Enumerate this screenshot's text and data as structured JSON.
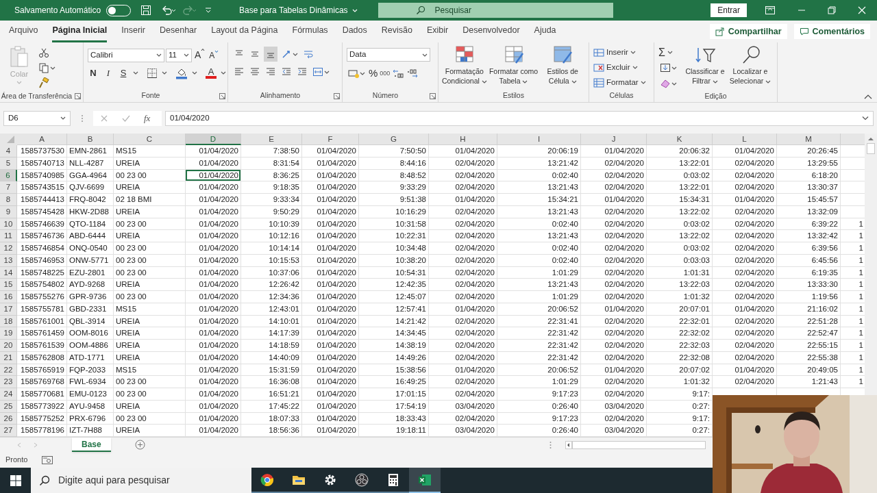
{
  "title_bar": {
    "autosave_label": "Salvamento Automático",
    "autosave_on": false,
    "document_title": "Base para Tabelas Dinâmicas",
    "search_placeholder": "Pesquisar",
    "sign_in": "Entrar"
  },
  "menu_tabs": [
    {
      "label": "Arquivo",
      "selected": false
    },
    {
      "label": "Página Inicial",
      "selected": true
    },
    {
      "label": "Inserir",
      "selected": false
    },
    {
      "label": "Desenhar",
      "selected": false
    },
    {
      "label": "Layout da Página",
      "selected": false
    },
    {
      "label": "Fórmulas",
      "selected": false
    },
    {
      "label": "Dados",
      "selected": false
    },
    {
      "label": "Revisão",
      "selected": false
    },
    {
      "label": "Exibir",
      "selected": false
    },
    {
      "label": "Desenvolvedor",
      "selected": false
    },
    {
      "label": "Ajuda",
      "selected": false
    }
  ],
  "share_buttons": [
    "Compartilhar",
    "Comentários"
  ],
  "ribbon": {
    "clipboard": {
      "label": "Área de Transferência",
      "paste": {
        "label": "Colar",
        "disabled": true
      }
    },
    "font": {
      "label": "Fonte",
      "name": "Calibri",
      "size": "11",
      "grow": "A",
      "shrink": "A",
      "styles": [
        "N",
        "I",
        "S"
      ],
      "font_color": "A"
    },
    "alignment": {
      "label": "Alinhamento",
      "vertical": [
        {
          "kind": "top",
          "selected": false
        },
        {
          "kind": "middle",
          "selected": false
        },
        {
          "kind": "bottom",
          "selected": true
        }
      ]
    },
    "number": {
      "label": "Número",
      "format": "Data",
      "percent": "%",
      "thousands": "000"
    },
    "styles": {
      "label": "Estilos",
      "buttons": [
        "Formatação Condicional",
        "Formatar como Tabela",
        "Estilos de Célula"
      ]
    },
    "cells": {
      "label": "Células",
      "buttons": [
        "Inserir",
        "Excluir",
        "Formatar"
      ]
    },
    "editing": {
      "label": "Edição",
      "sum": "Σ",
      "buttons": [
        "Classificar e Filtrar",
        "Localizar e Selecionar"
      ]
    }
  },
  "formula_bar": {
    "name_box": "D6",
    "function_label": "fx",
    "value": "01/04/2020"
  },
  "columns": [
    {
      "label": "A",
      "selected": false
    },
    {
      "label": "B",
      "selected": false
    },
    {
      "label": "C",
      "selected": false
    },
    {
      "label": "D",
      "selected": true
    },
    {
      "label": "E",
      "selected": false
    },
    {
      "label": "F",
      "selected": false
    },
    {
      "label": "G",
      "selected": false
    },
    {
      "label": "H",
      "selected": false
    },
    {
      "label": "I",
      "selected": false
    },
    {
      "label": "J",
      "selected": false
    },
    {
      "label": "K",
      "selected": false
    },
    {
      "label": "L",
      "selected": false
    },
    {
      "label": "M",
      "selected": false
    }
  ],
  "rows": [
    {
      "number": "4",
      "selected": false,
      "cells": [
        "1585737530",
        "EMN-2861",
        "MS15",
        "01/04/2020",
        "7:38:50",
        "01/04/2020",
        "7:50:50",
        "01/04/2020",
        "20:06:19",
        "01/04/2020",
        "20:06:32",
        "01/04/2020",
        "20:26:45"
      ]
    },
    {
      "number": "5",
      "selected": false,
      "cells": [
        "1585740713",
        "NLL-4287",
        "UREIA",
        "01/04/2020",
        "8:31:54",
        "01/04/2020",
        "8:44:16",
        "02/04/2020",
        "13:21:42",
        "02/04/2020",
        "13:22:01",
        "02/04/2020",
        "13:29:55"
      ]
    },
    {
      "number": "6",
      "selected": true,
      "cells": [
        "1585740985",
        "GGA-4964",
        "00 23 00",
        "01/04/2020",
        "8:36:25",
        "01/04/2020",
        "8:48:52",
        "02/04/2020",
        "0:02:40",
        "02/04/2020",
        "0:03:02",
        "02/04/2020",
        "6:18:20"
      ]
    },
    {
      "number": "7",
      "selected": false,
      "cells": [
        "1585743515",
        "QJV-6699",
        "UREIA",
        "01/04/2020",
        "9:18:35",
        "01/04/2020",
        "9:33:29",
        "02/04/2020",
        "13:21:43",
        "02/04/2020",
        "13:22:01",
        "02/04/2020",
        "13:30:37"
      ]
    },
    {
      "number": "8",
      "selected": false,
      "cells": [
        "1585744413",
        "FRQ-8042",
        "02 18 BMI",
        "01/04/2020",
        "9:33:34",
        "01/04/2020",
        "9:51:38",
        "01/04/2020",
        "15:34:21",
        "01/04/2020",
        "15:34:31",
        "01/04/2020",
        "15:45:57"
      ]
    },
    {
      "number": "9",
      "selected": false,
      "cells": [
        "1585745428",
        "HKW-2D88",
        "UREIA",
        "01/04/2020",
        "9:50:29",
        "01/04/2020",
        "10:16:29",
        "02/04/2020",
        "13:21:43",
        "02/04/2020",
        "13:22:02",
        "02/04/2020",
        "13:32:09"
      ]
    },
    {
      "number": "10",
      "selected": false,
      "cells": [
        "1585746639",
        "QTO-1184",
        "00 23 00",
        "01/04/2020",
        "10:10:39",
        "01/04/2020",
        "10:31:58",
        "02/04/2020",
        "0:02:40",
        "02/04/2020",
        "0:03:02",
        "02/04/2020",
        "6:39:22"
      ],
      "overflow": "1"
    },
    {
      "number": "11",
      "selected": false,
      "cells": [
        "1585746736",
        "ABD-6444",
        "UREIA",
        "01/04/2020",
        "10:12:16",
        "01/04/2020",
        "10:22:31",
        "02/04/2020",
        "13:21:43",
        "02/04/2020",
        "13:22:02",
        "02/04/2020",
        "13:32:42"
      ],
      "overflow": "1"
    },
    {
      "number": "12",
      "selected": false,
      "cells": [
        "1585746854",
        "ONQ-0540",
        "00 23 00",
        "01/04/2020",
        "10:14:14",
        "01/04/2020",
        "10:34:48",
        "02/04/2020",
        "0:02:40",
        "02/04/2020",
        "0:03:02",
        "02/04/2020",
        "6:39:56"
      ],
      "overflow": "1"
    },
    {
      "number": "13",
      "selected": false,
      "cells": [
        "1585746953",
        "ONW-5771",
        "00 23 00",
        "01/04/2020",
        "10:15:53",
        "01/04/2020",
        "10:38:20",
        "02/04/2020",
        "0:02:40",
        "02/04/2020",
        "0:03:03",
        "02/04/2020",
        "6:45:56"
      ],
      "overflow": "1"
    },
    {
      "number": "14",
      "selected": false,
      "cells": [
        "1585748225",
        "EZU-2801",
        "00 23 00",
        "01/04/2020",
        "10:37:06",
        "01/04/2020",
        "10:54:31",
        "02/04/2020",
        "1:01:29",
        "02/04/2020",
        "1:01:31",
        "02/04/2020",
        "6:19:35"
      ],
      "overflow": "1"
    },
    {
      "number": "15",
      "selected": false,
      "cells": [
        "1585754802",
        "AYD-9268",
        "UREIA",
        "01/04/2020",
        "12:26:42",
        "01/04/2020",
        "12:42:35",
        "02/04/2020",
        "13:21:43",
        "02/04/2020",
        "13:22:03",
        "02/04/2020",
        "13:33:30"
      ],
      "overflow": "1"
    },
    {
      "number": "16",
      "selected": false,
      "cells": [
        "1585755276",
        "GPR-9736",
        "00 23 00",
        "01/04/2020",
        "12:34:36",
        "01/04/2020",
        "12:45:07",
        "02/04/2020",
        "1:01:29",
        "02/04/2020",
        "1:01:32",
        "02/04/2020",
        "1:19:56"
      ],
      "overflow": "1"
    },
    {
      "number": "17",
      "selected": false,
      "cells": [
        "1585755781",
        "GBD-2331",
        "MS15",
        "01/04/2020",
        "12:43:01",
        "01/04/2020",
        "12:57:41",
        "01/04/2020",
        "20:06:52",
        "01/04/2020",
        "20:07:01",
        "01/04/2020",
        "21:16:02"
      ],
      "overflow": "1"
    },
    {
      "number": "18",
      "selected": false,
      "cells": [
        "1585761001",
        "QBL-3914",
        "UREIA",
        "01/04/2020",
        "14:10:01",
        "01/04/2020",
        "14:21:42",
        "02/04/2020",
        "22:31:41",
        "02/04/2020",
        "22:32:01",
        "02/04/2020",
        "22:51:28"
      ],
      "overflow": "1"
    },
    {
      "number": "19",
      "selected": false,
      "cells": [
        "1585761459",
        "OOM-8016",
        "UREIA",
        "01/04/2020",
        "14:17:39",
        "01/04/2020",
        "14:34:45",
        "02/04/2020",
        "22:31:42",
        "02/04/2020",
        "22:32:02",
        "02/04/2020",
        "22:52:47"
      ],
      "overflow": "1"
    },
    {
      "number": "20",
      "selected": false,
      "cells": [
        "1585761539",
        "OOM-4886",
        "UREIA",
        "01/04/2020",
        "14:18:59",
        "01/04/2020",
        "14:38:19",
        "02/04/2020",
        "22:31:42",
        "02/04/2020",
        "22:32:03",
        "02/04/2020",
        "22:55:15"
      ],
      "overflow": "1"
    },
    {
      "number": "21",
      "selected": false,
      "cells": [
        "1585762808",
        "ATD-1771",
        "UREIA",
        "01/04/2020",
        "14:40:09",
        "01/04/2020",
        "14:49:26",
        "02/04/2020",
        "22:31:42",
        "02/04/2020",
        "22:32:08",
        "02/04/2020",
        "22:55:38"
      ],
      "overflow": "1"
    },
    {
      "number": "22",
      "selected": false,
      "cells": [
        "1585765919",
        "FQP-2033",
        "MS15",
        "01/04/2020",
        "15:31:59",
        "01/04/2020",
        "15:38:56",
        "01/04/2020",
        "20:06:52",
        "01/04/2020",
        "20:07:02",
        "01/04/2020",
        "20:49:05"
      ],
      "overflow": "1"
    },
    {
      "number": "23",
      "selected": false,
      "cells": [
        "1585769768",
        "FWL-6934",
        "00 23 00",
        "01/04/2020",
        "16:36:08",
        "01/04/2020",
        "16:49:25",
        "02/04/2020",
        "1:01:29",
        "02/04/2020",
        "1:01:32",
        "02/04/2020",
        "1:21:43"
      ],
      "overflow": "1"
    },
    {
      "number": "24",
      "selected": false,
      "cells": [
        "1585770681",
        "EMU-0123",
        "00 23 00",
        "01/04/2020",
        "16:51:21",
        "01/04/2020",
        "17:01:15",
        "02/04/2020",
        "9:17:23",
        "02/04/2020",
        "9:17:"
      ]
    },
    {
      "number": "25",
      "selected": false,
      "cells": [
        "1585773922",
        "AYU-9458",
        "UREIA",
        "01/04/2020",
        "17:45:22",
        "01/04/2020",
        "17:54:19",
        "03/04/2020",
        "0:26:40",
        "03/04/2020",
        "0:27:"
      ]
    },
    {
      "number": "26",
      "selected": false,
      "cells": [
        "1585775252",
        "PRX-6796",
        "00 23 00",
        "01/04/2020",
        "18:07:33",
        "01/04/2020",
        "18:33:43",
        "02/04/2020",
        "9:17:23",
        "02/04/2020",
        "9:17:"
      ]
    },
    {
      "number": "27",
      "selected": false,
      "cells": [
        "1585778196",
        "IZT-7H88",
        "UREIA",
        "01/04/2020",
        "18:56:36",
        "01/04/2020",
        "19:18:11",
        "03/04/2020",
        "0:26:40",
        "03/04/2020",
        "0:27:"
      ]
    }
  ],
  "sheet_tabs": [
    {
      "label": "Base",
      "selected": true
    }
  ],
  "status_bar": {
    "text": "Pronto"
  },
  "taskbar": {
    "search_placeholder": "Digite aqui para pesquisar",
    "apps": [
      {
        "kind": "browser",
        "active": false
      },
      {
        "kind": "folder",
        "active": false
      },
      {
        "kind": "settings",
        "active": false
      },
      {
        "kind": "recorder",
        "active": false
      },
      {
        "kind": "calculator",
        "active": false
      },
      {
        "kind": "spreadsheet",
        "active": true
      }
    ]
  },
  "webcam": {
    "kind": "picture"
  }
}
